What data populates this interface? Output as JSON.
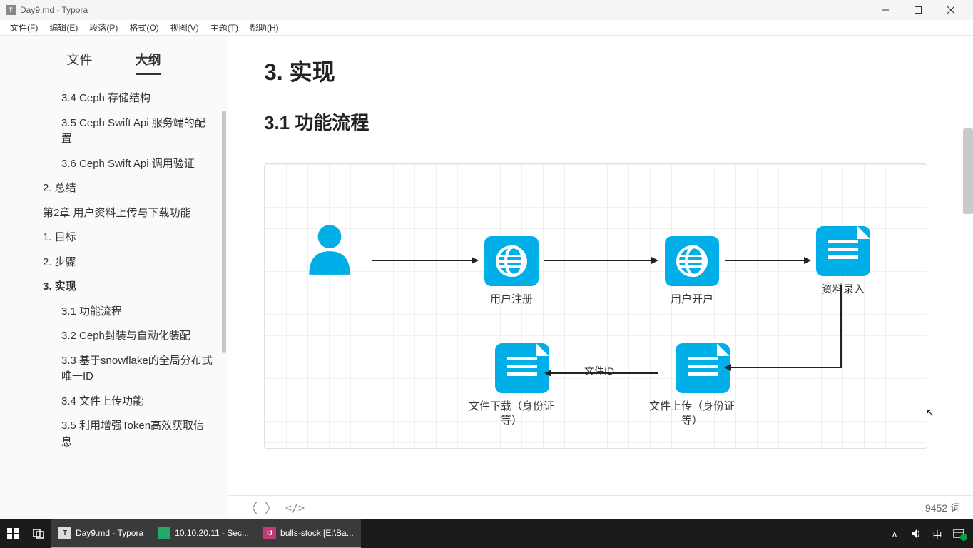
{
  "window": {
    "title": "Day9.md - Typora"
  },
  "menu": [
    "文件(F)",
    "编辑(E)",
    "段落(P)",
    "格式(O)",
    "视图(V)",
    "主题(T)",
    "帮助(H)"
  ],
  "sidebar": {
    "tabs": {
      "file": "文件",
      "outline": "大纲"
    },
    "items": [
      {
        "label": "3.4 Ceph 存储结构",
        "level": 3
      },
      {
        "label": "3.5 Ceph Swift Api 服务端的配置",
        "level": 3
      },
      {
        "label": "3.6 Ceph Swift Api 调用验证",
        "level": 3
      },
      {
        "label": "2. 总结",
        "level": 2
      },
      {
        "label": "第2章 用户资料上传与下载功能",
        "level": 2
      },
      {
        "label": "1. 目标",
        "level": 2
      },
      {
        "label": "2. 步骤",
        "level": 2
      },
      {
        "label": "3. 实现",
        "level": 2,
        "active": true
      },
      {
        "label": "3.1 功能流程",
        "level": 3
      },
      {
        "label": "3.2 Ceph封装与自动化装配",
        "level": 3
      },
      {
        "label": "3.3 基于snowflake的全局分布式唯一ID",
        "level": 3
      },
      {
        "label": "3.4 文件上传功能",
        "level": 3
      },
      {
        "label": "3.5 利用增强Token高效获取信息",
        "level": 3
      }
    ]
  },
  "content": {
    "h1": "3. 实现",
    "h2": "3.1 功能流程",
    "diagram": {
      "n1": "用户注册",
      "n2": "用户开户",
      "n3": "资料录入",
      "n4": "文件上传（身份证等）",
      "n5": "文件下载（身份证等）",
      "edge_label": "文件ID"
    }
  },
  "status": {
    "words": "9452 词"
  },
  "taskbar": {
    "t1": "Day9.md - Typora",
    "t2": "10.10.20.11 - Sec...",
    "t3": "bulls-stock [E:\\Ba...",
    "ime": "中"
  }
}
